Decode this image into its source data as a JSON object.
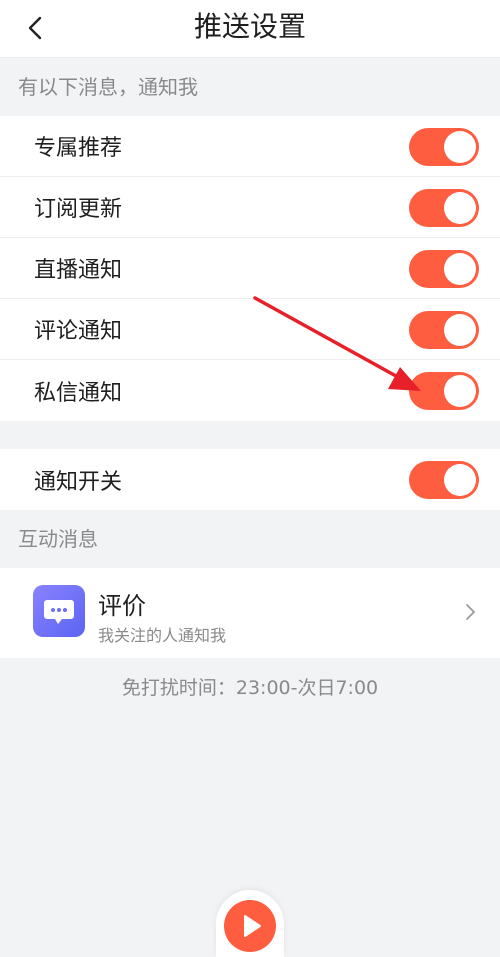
{
  "header": {
    "title": "推送设置",
    "back_icon": "chevron-left-icon"
  },
  "notify_section": {
    "heading": "有以下消息，通知我",
    "items": [
      {
        "label": "专属推荐",
        "on": true
      },
      {
        "label": "订阅更新",
        "on": true
      },
      {
        "label": "直播通知",
        "on": true
      },
      {
        "label": "评论通知",
        "on": true
      },
      {
        "label": "私信通知",
        "on": true
      }
    ]
  },
  "master_switch": {
    "label": "通知开关",
    "on": true
  },
  "interaction_section": {
    "heading": "互动消息",
    "item": {
      "title": "评价",
      "subtitle": "我关注的人通知我",
      "icon": "chat-bubble-icon"
    }
  },
  "dnd_text": "免打扰时间：23:00-次日7:00",
  "colors": {
    "accent": "#fe5d3f",
    "background": "#f2f3f5",
    "icon_gradient_start": "#8a82ff",
    "icon_gradient_end": "#5b64f2",
    "annotation_arrow": "#e8202a"
  }
}
